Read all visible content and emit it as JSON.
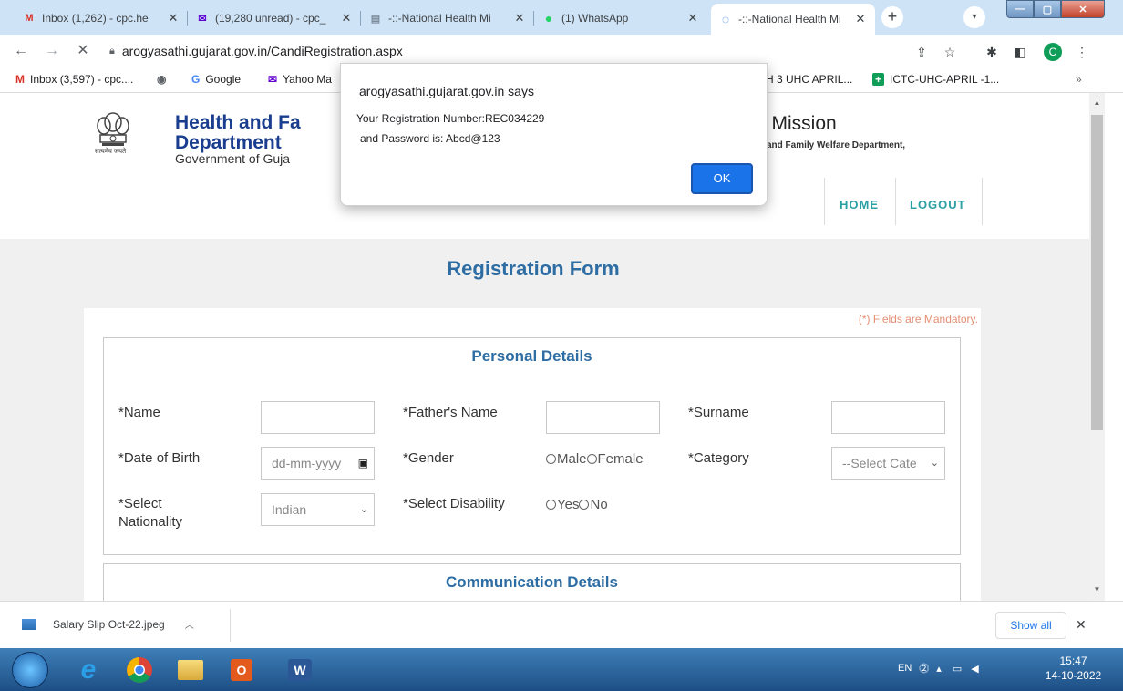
{
  "browser": {
    "tabs": [
      {
        "icon": "gmail-icon",
        "icon_glyph": "M",
        "title": "Inbox (1,262) - cpc.he"
      },
      {
        "icon": "yahoo-mail-icon",
        "icon_glyph": "✉",
        "title": "(19,280 unread) - cpc_"
      },
      {
        "icon": "page-icon",
        "icon_glyph": "▤",
        "title": "-::-National Health Mi"
      },
      {
        "icon": "whatsapp-icon",
        "icon_glyph": "●",
        "title": "(1) WhatsApp"
      },
      {
        "icon": "loading-icon",
        "icon_glyph": "◌",
        "title": "-::-National Health Mi"
      }
    ],
    "url": "arogyasathi.gujarat.gov.in/CandiRegistration.aspx",
    "profile_initial": "C",
    "bookmarks": [
      {
        "icon": "gmail-icon",
        "glyph": "M",
        "label": "Inbox (3,597) - cpc...."
      },
      {
        "icon": "globe-icon",
        "glyph": "◉",
        "label": ""
      },
      {
        "icon": "google-icon",
        "glyph": "G",
        "label": "Google"
      },
      {
        "icon": "yahoo-mail-icon",
        "glyph": "✉",
        "label": "Yahoo Ma"
      },
      {
        "icon": "page-icon",
        "glyph": "",
        "label": "SH 3 UHC APRIL..."
      },
      {
        "icon": "sheets-icon",
        "glyph": "+",
        "label": "ICTC-UHC-APRIL -1..."
      }
    ],
    "bookmarks_overflow": "»"
  },
  "site": {
    "dept_title_line1": "Health and Fa",
    "dept_title_line2": "Department",
    "dept_subtitle": "Government of Guja",
    "emblem_motto": "सत्यमेव जयते",
    "mission_title": "n Mission",
    "mission_subtitle": "and Family Welfare Department,",
    "nav": {
      "home": "HOME",
      "logout": "LOGOUT"
    }
  },
  "form": {
    "title": "Registration Form",
    "mandatory_note": "(*) Fields are Mandatory.",
    "personal_section_title": "Personal Details",
    "fields": {
      "name": "*Name",
      "fathers_name": "*Father's Name",
      "surname": "*Surname",
      "dob": "*Date of Birth",
      "dob_placeholder": "dd-mm-yyyy",
      "gender": "*Gender",
      "gender_male": "Male",
      "gender_female": "Female",
      "category": "*Category",
      "category_value": "--Select Cate",
      "nationality_line1": "*Select",
      "nationality_line2": "Nationality",
      "nationality_value": "Indian",
      "disability": "*Select Disability",
      "disability_yes": "Yes",
      "disability_no": "No"
    },
    "communication_section_title": "Communication Details"
  },
  "dialog": {
    "origin": "arogyasathi.gujarat.gov.in says",
    "message_line1": "Your Registration Number:REC034229",
    "message_line2": "and Password is: Abcd@123",
    "ok_label": "OK"
  },
  "downloads": {
    "file_name": "Salary Slip Oct-22.jpeg",
    "show_all": "Show all"
  },
  "taskbar": {
    "language": "EN",
    "time": "15:47",
    "date": "14-10-2022"
  },
  "colors": {
    "accent_blue": "#2d6da3",
    "nav_teal": "#2aa0a3",
    "dialog_ok": "#1a73e8",
    "mandatory": "#e58e73"
  }
}
